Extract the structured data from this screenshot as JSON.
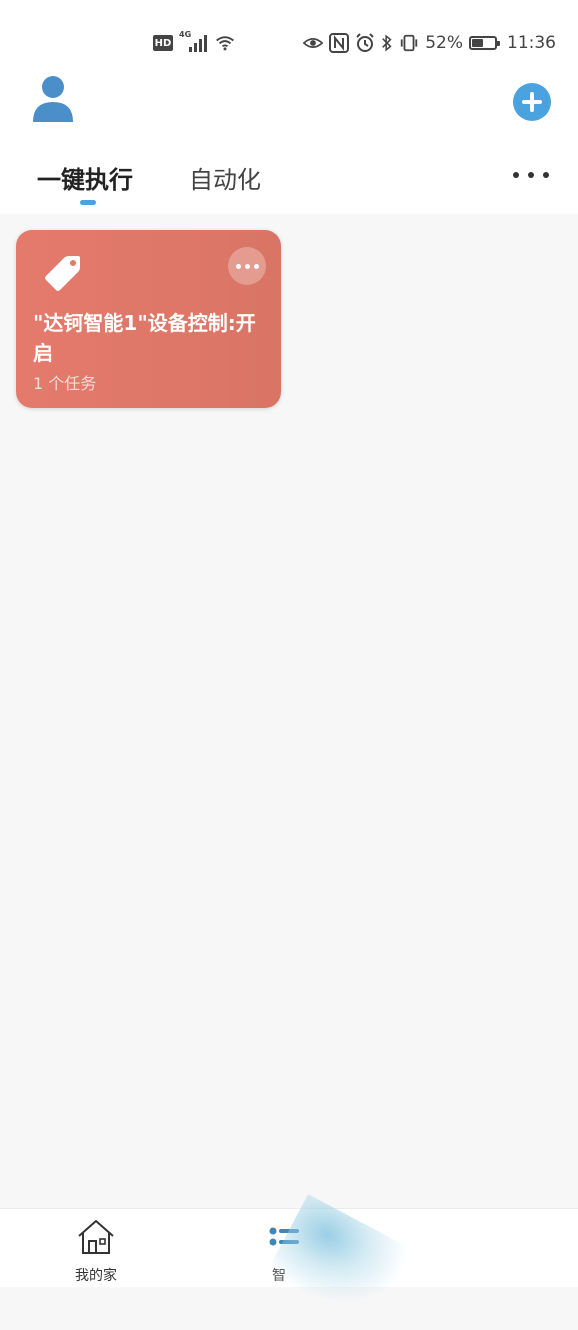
{
  "status_bar": {
    "hd_label": "HD",
    "signal_label": "4G",
    "battery_percent_text": "52%",
    "battery_level": 0.52,
    "time": "11:36",
    "icons": [
      "eye-icon",
      "nfc-icon",
      "alarm-icon",
      "bluetooth-icon",
      "vibrate-icon"
    ]
  },
  "header": {
    "avatar_icon": "user-avatar-icon",
    "add_icon": "plus-icon",
    "tabs": [
      {
        "label": "一键执行",
        "active": true
      },
      {
        "label": "自动化",
        "active": false
      }
    ],
    "more_icon": "ellipsis-icon"
  },
  "scenes": [
    {
      "title": "\"达钶智能1\"设备控制:开启",
      "subtitle": "1 个任务",
      "icon": "tag-icon",
      "color": "#e2796b"
    }
  ],
  "bottom_nav": {
    "items": [
      {
        "label": "我的家",
        "icon": "home-icon"
      },
      {
        "label": "智",
        "icon": "scene-list-icon"
      }
    ],
    "accent": "#4aa3df"
  }
}
